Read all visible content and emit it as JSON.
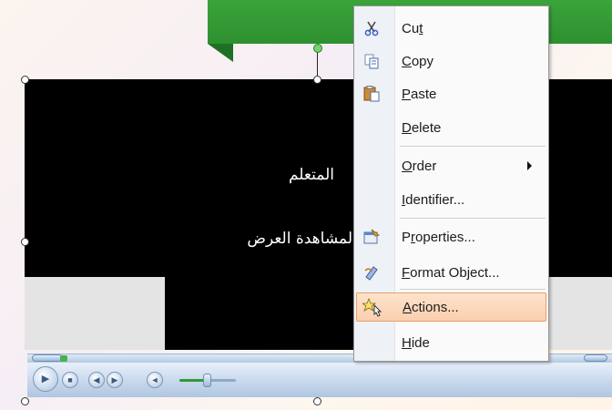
{
  "banner": {
    "text": "ﷺ"
  },
  "video": {
    "line1": "المتعلم",
    "line2": "لمشاهدة العرض"
  },
  "player": {
    "play_icon": "play-icon",
    "stop_icon": "stop-icon",
    "prev_icon": "previous-icon",
    "next_icon": "next-icon",
    "mute_icon": "volume-icon",
    "volume_level": 0.55,
    "seek_position": 0.0
  },
  "context_menu": {
    "items": [
      {
        "label": "Cut",
        "access_key": "t",
        "icon": "scissors-icon"
      },
      {
        "label": "Copy",
        "access_key": "C",
        "icon": "copy-icon"
      },
      {
        "label": "Paste",
        "access_key": "P",
        "icon": "paste-icon"
      },
      {
        "label": "Delete",
        "access_key": "D",
        "icon": ""
      },
      {
        "label": "Order",
        "access_key": "O",
        "icon": "",
        "submenu": true
      },
      {
        "label": "Identifier...",
        "access_key": "I",
        "icon": ""
      },
      {
        "label": "Properties...",
        "access_key": "r",
        "icon": "properties-icon"
      },
      {
        "label": "Format Object...",
        "access_key": "F",
        "icon": "format-object-icon"
      },
      {
        "label": "Actions...",
        "access_key": "A",
        "icon": "actions-icon",
        "highlighted": true
      },
      {
        "label": "Hide",
        "access_key": "H",
        "icon": ""
      }
    ]
  },
  "colors": {
    "banner_green": "#2e9030",
    "menu_highlight": "#fbcfae",
    "menu_highlight_border": "#e79f6b"
  }
}
